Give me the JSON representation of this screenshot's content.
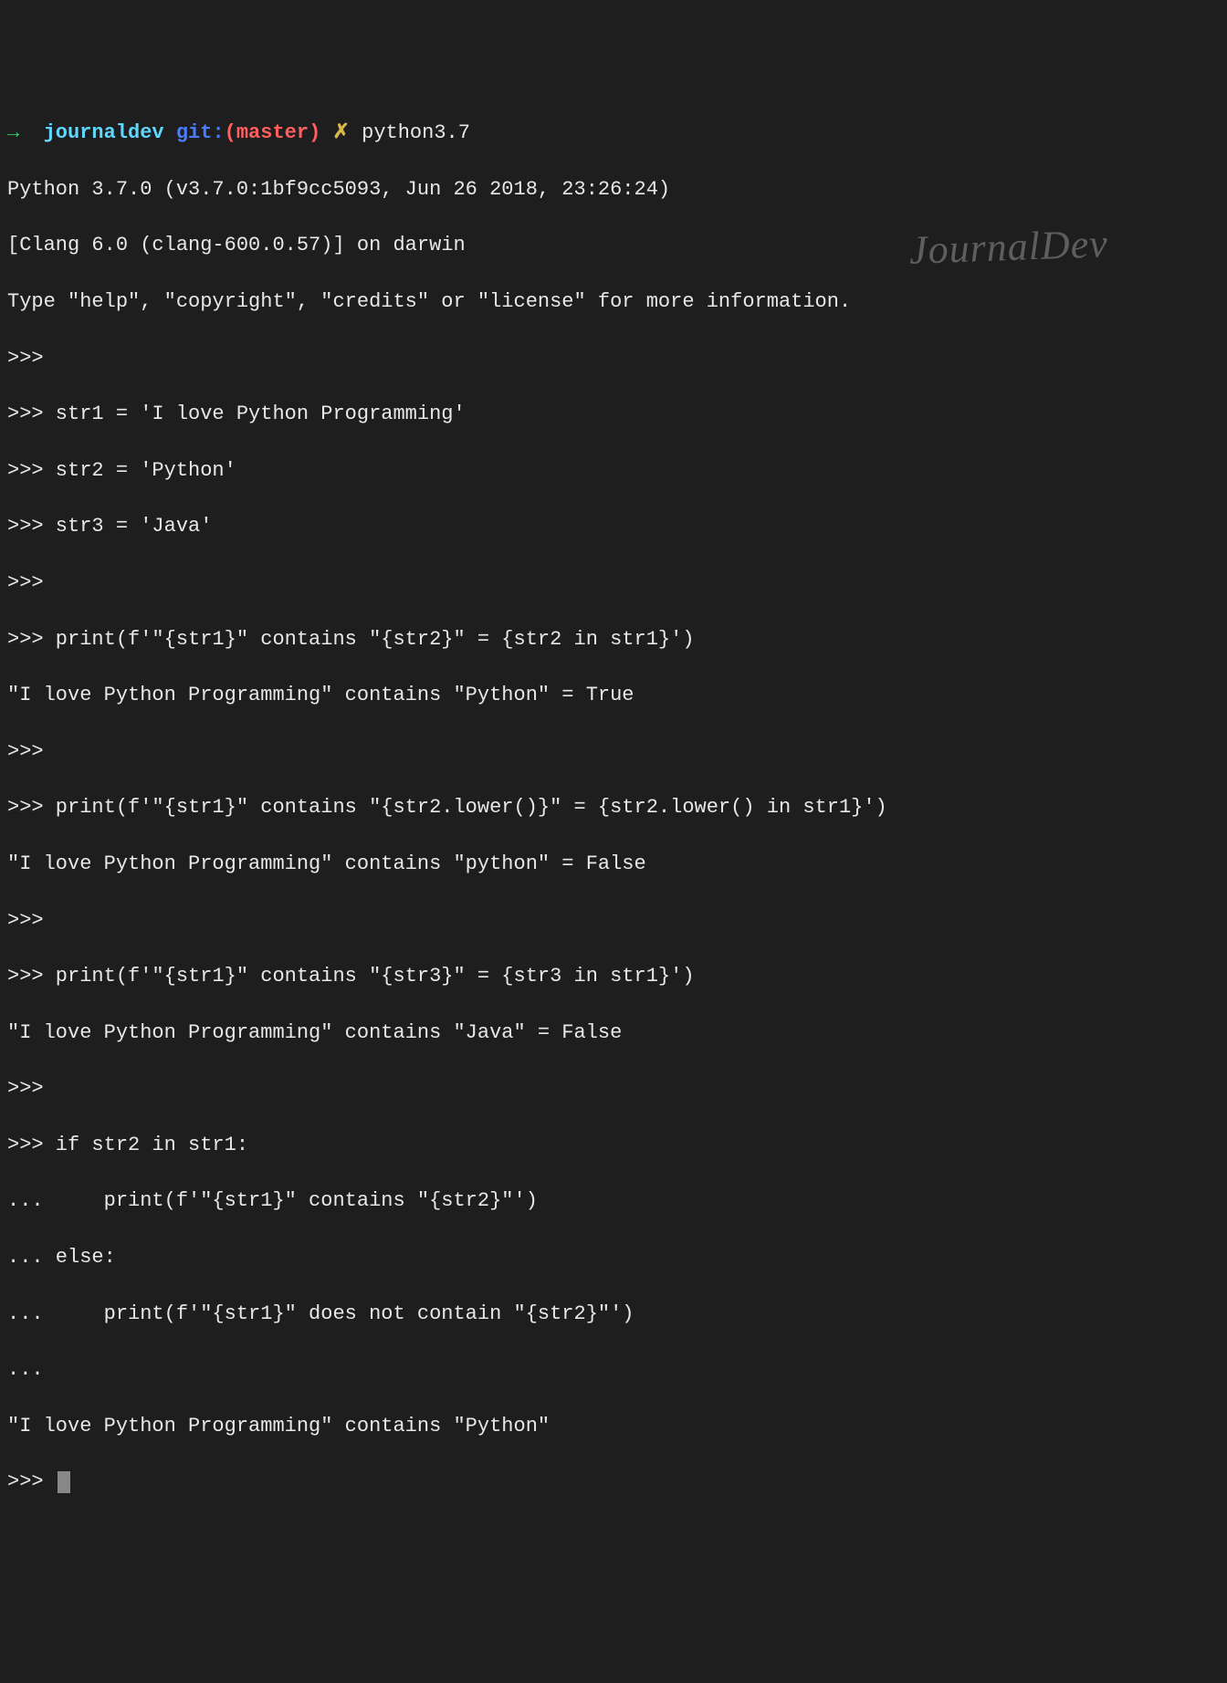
{
  "prompt": {
    "arrow": "→",
    "dir": "journaldev",
    "git_label": "git:",
    "branch": "(master)",
    "dirty": "✗",
    "command": "python3.7"
  },
  "lines": {
    "l01": "Python 3.7.0 (v3.7.0:1bf9cc5093, Jun 26 2018, 23:26:24)",
    "l02": "[Clang 6.0 (clang-600.0.57)] on darwin",
    "l03": "Type \"help\", \"copyright\", \"credits\" or \"license\" for more information.",
    "l04": ">>>",
    "l05": ">>> str1 = 'I love Python Programming'",
    "l06": ">>> str2 = 'Python'",
    "l07": ">>> str3 = 'Java'",
    "l08": ">>>",
    "l09": ">>> print(f'\"{str1}\" contains \"{str2}\" = {str2 in str1}')",
    "l10": "\"I love Python Programming\" contains \"Python\" = True",
    "l11": ">>>",
    "l12": ">>> print(f'\"{str1}\" contains \"{str2.lower()}\" = {str2.lower() in str1}')",
    "l13": "\"I love Python Programming\" contains \"python\" = False",
    "l14": ">>>",
    "l15": ">>> print(f'\"{str1}\" contains \"{str3}\" = {str3 in str1}')",
    "l16": "\"I love Python Programming\" contains \"Java\" = False",
    "l17": ">>>",
    "l18": ">>> if str2 in str1:",
    "l19": "...     print(f'\"{str1}\" contains \"{str2}\"')",
    "l20": "... else:",
    "l21": "...     print(f'\"{str1}\" does not contain \"{str2}\"')",
    "l22": "...",
    "l23": "\"I love Python Programming\" contains \"Python\"",
    "l24": ">>> "
  },
  "watermark": "JournalDev"
}
